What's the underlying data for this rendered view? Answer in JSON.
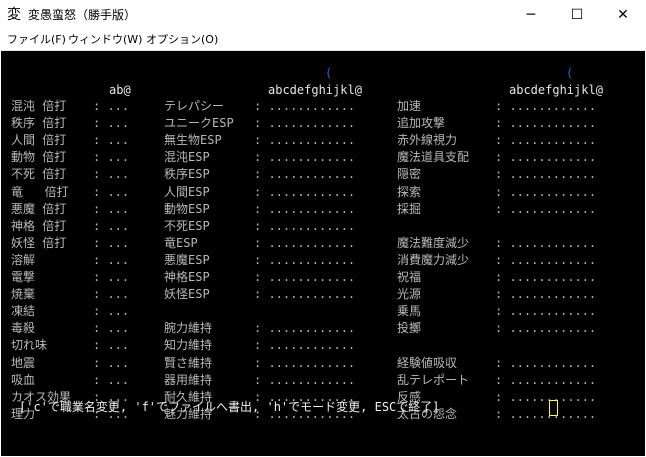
{
  "window": {
    "title": "変愚蛮怒（勝手版）",
    "icon": "変",
    "minimize": "─",
    "maximize": "☐",
    "close": "✕"
  },
  "menu": [
    {
      "label": "ファイル(F)"
    },
    {
      "label": "ウィンドウ(W)"
    },
    {
      "label": "オプション(O)"
    }
  ],
  "columns": {
    "col1": {
      "header": "ab@",
      "rows": [
        {
          "label": "混沌 倍打",
          "value": ": ..."
        },
        {
          "label": "秩序 倍打",
          "value": ": ..."
        },
        {
          "label": "人間 倍打",
          "value": ": ..."
        },
        {
          "label": "動物 倍打",
          "value": ": ..."
        },
        {
          "label": "不死 倍打",
          "value": ": ..."
        },
        {
          "label": "竜   倍打",
          "value": ": ..."
        },
        {
          "label": "悪魔 倍打",
          "value": ": ..."
        },
        {
          "label": "神格 倍打",
          "value": ": ..."
        },
        {
          "label": "妖怪 倍打",
          "value": ": ..."
        },
        {
          "label": "溶解",
          "value": ": ..."
        },
        {
          "label": "電撃",
          "value": ": ..."
        },
        {
          "label": "焼棄",
          "value": ": ..."
        },
        {
          "label": "凍結",
          "value": ": ..."
        },
        {
          "label": "毒殺",
          "value": ": ..."
        },
        {
          "label": "切れ味",
          "value": ": ..."
        },
        {
          "label": "地震",
          "value": ": ..."
        },
        {
          "label": "吸血",
          "value": ": ..."
        },
        {
          "label": "カオス効果",
          "value": ": ..."
        },
        {
          "label": "理力",
          "value": ": ..."
        }
      ]
    },
    "col2": {
      "header": "abcdefghijkl@",
      "marker": "(",
      "rows": [
        {
          "label": "テレパシー",
          "value": ": ............"
        },
        {
          "label": "ユニークESP",
          "value": ": ............"
        },
        {
          "label": "無生物ESP",
          "value": ": ............"
        },
        {
          "label": "混沌ESP",
          "value": ": ............"
        },
        {
          "label": "秩序ESP",
          "value": ": ............"
        },
        {
          "label": "人間ESP",
          "value": ": ............"
        },
        {
          "label": "動物ESP",
          "value": ": ............"
        },
        {
          "label": "不死ESP",
          "value": ": ............"
        },
        {
          "label": "竜ESP",
          "value": ": ............"
        },
        {
          "label": "悪魔ESP",
          "value": ": ............"
        },
        {
          "label": "神格ESP",
          "value": ": ............"
        },
        {
          "label": "妖怪ESP",
          "value": ": ............"
        },
        {
          "label": "",
          "value": ""
        },
        {
          "label": "腕力維持",
          "value": ": ............"
        },
        {
          "label": "知力維持",
          "value": ": ............"
        },
        {
          "label": "賢さ維持",
          "value": ": ............"
        },
        {
          "label": "器用維持",
          "value": ": ............"
        },
        {
          "label": "耐久維持",
          "value": ": ............"
        },
        {
          "label": "魅力維持",
          "value": ": ............"
        }
      ]
    },
    "col3": {
      "header": "abcdefghijkl@",
      "marker": "(",
      "rows": [
        {
          "label": "加速",
          "value": ": ............"
        },
        {
          "label": "追加攻撃",
          "value": ": ............"
        },
        {
          "label": "赤外線視力",
          "value": ": ............"
        },
        {
          "label": "魔法道具支配",
          "value": ": ............"
        },
        {
          "label": "隠密",
          "value": ": ............"
        },
        {
          "label": "探索",
          "value": ": ............"
        },
        {
          "label": "採掘",
          "value": ": ............"
        },
        {
          "label": "",
          "value": ""
        },
        {
          "label": "魔法難度減少",
          "value": ": ............"
        },
        {
          "label": "消費魔力減少",
          "value": ": ............"
        },
        {
          "label": "祝福",
          "value": ": ............"
        },
        {
          "label": "光源",
          "value": ": ............"
        },
        {
          "label": "乗馬",
          "value": ": ............"
        },
        {
          "label": "投擲",
          "value": ": ............"
        },
        {
          "label": "",
          "value": ""
        },
        {
          "label": "経験値吸収",
          "value": ": ............"
        },
        {
          "label": "乱テレポート",
          "value": ": ............"
        },
        {
          "label": "反感",
          "value": ": ............"
        },
        {
          "label": "太古の怨念",
          "value": ": ............"
        }
      ]
    }
  },
  "prompt": "['c'で職業名変更, 'f'でファイルへ書出, 'h'でモード変更, ESCで終了]",
  "colors": {
    "terminal_bg": "#000000",
    "text": "#b8b8b8",
    "marker": "#1f6bd6",
    "cursor": "#ffff00"
  }
}
